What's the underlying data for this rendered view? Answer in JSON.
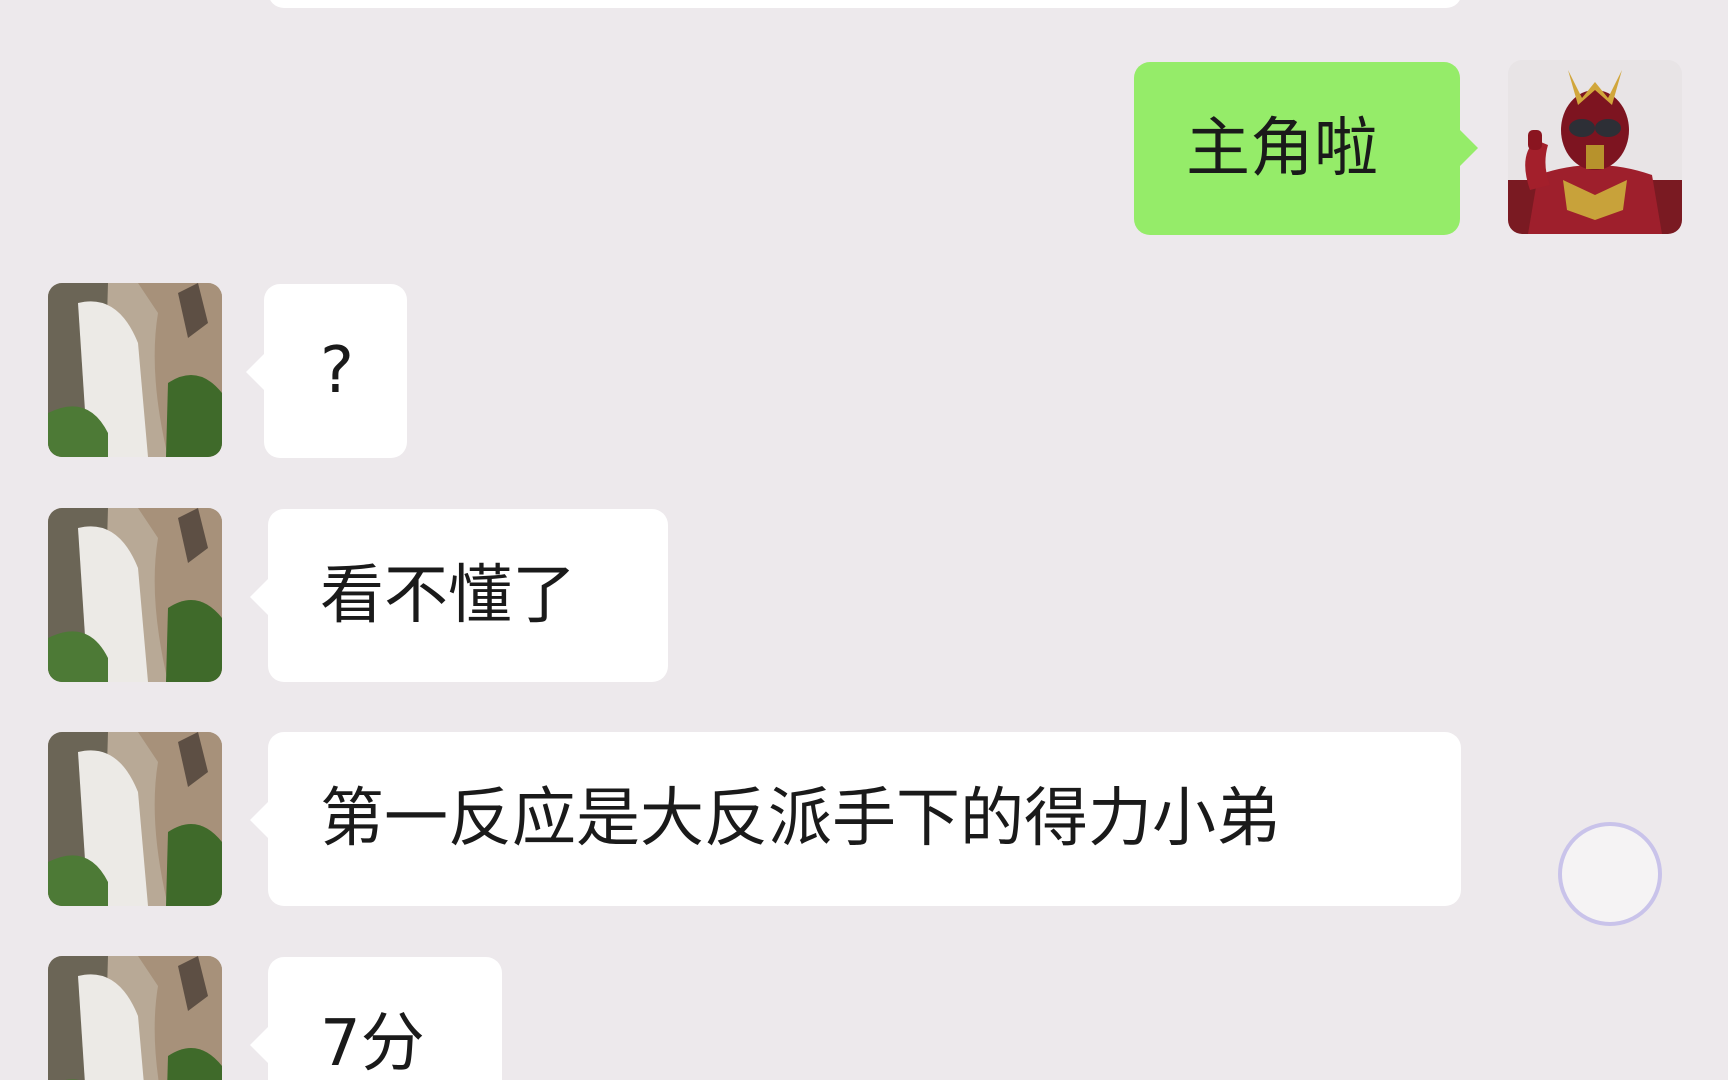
{
  "conversation": {
    "messages": [
      {
        "sender": "self",
        "avatar": "red-armored-hero-avatar",
        "text": "主角啦"
      },
      {
        "sender": "contact",
        "avatar": "waterfall-avatar",
        "text": "?"
      },
      {
        "sender": "contact",
        "avatar": "waterfall-avatar",
        "text": "看不懂了"
      },
      {
        "sender": "contact",
        "avatar": "waterfall-avatar",
        "text": "第一反应是大反派手下的得力小弟"
      },
      {
        "sender": "contact",
        "avatar": "waterfall-avatar",
        "text": "7分"
      }
    ]
  },
  "colors": {
    "background": "#ede9ec",
    "incoming_bubble": "#ffffff",
    "outgoing_bubble": "#95ec69",
    "floating_button_ring": "#c9c3ea"
  }
}
